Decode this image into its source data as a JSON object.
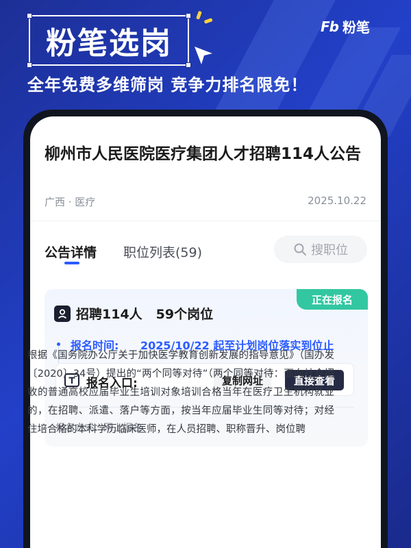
{
  "hero": {
    "title": "粉笔选岗",
    "subtitle": "全年免费多维筛岗  竞争力排名限免！"
  },
  "brand": {
    "mark": "Fb",
    "name": "粉笔"
  },
  "article": {
    "title": "柳州市人民医院医疗集团人才招聘114人公告",
    "meta_left": "广西 · 医疗",
    "date": "2025.10.22"
  },
  "tabs": [
    {
      "label": "公告详情",
      "active": true
    },
    {
      "label": "职位列表(59)",
      "active": false
    }
  ],
  "search": {
    "label": "搜职位"
  },
  "card": {
    "badge": "正在报名",
    "recruit": "招聘114人",
    "positions": "59个岗位",
    "time_label": "报名时间:",
    "time_value": "2025/10/22 起至计划岗位落实到位止",
    "entry_label": "报名入口:",
    "copy_button": "复制网址",
    "view_button": "直接查看",
    "method": "报名方式：网上报名"
  },
  "body": {
    "text": "根据《国务院办公厅关于加快医学教育创新发展的指导意见》（国办发〔2020〕34号）提出的“两个同等对待”（两个同等对待：面向社会招收的普通高校应届毕业生培训对象培训合格当年在医疗卫生机构就业的，在招聘、派遣、落户等方面，按当年应届毕业生同等对待；对经住培合格的本科学历临床医师，在人员招聘、职称晋升、岗位聘"
  },
  "colors": {
    "background": "#2240c8",
    "accent": "#2b5cff",
    "badge": "#32c7a1",
    "primary_button": "#262b45"
  }
}
